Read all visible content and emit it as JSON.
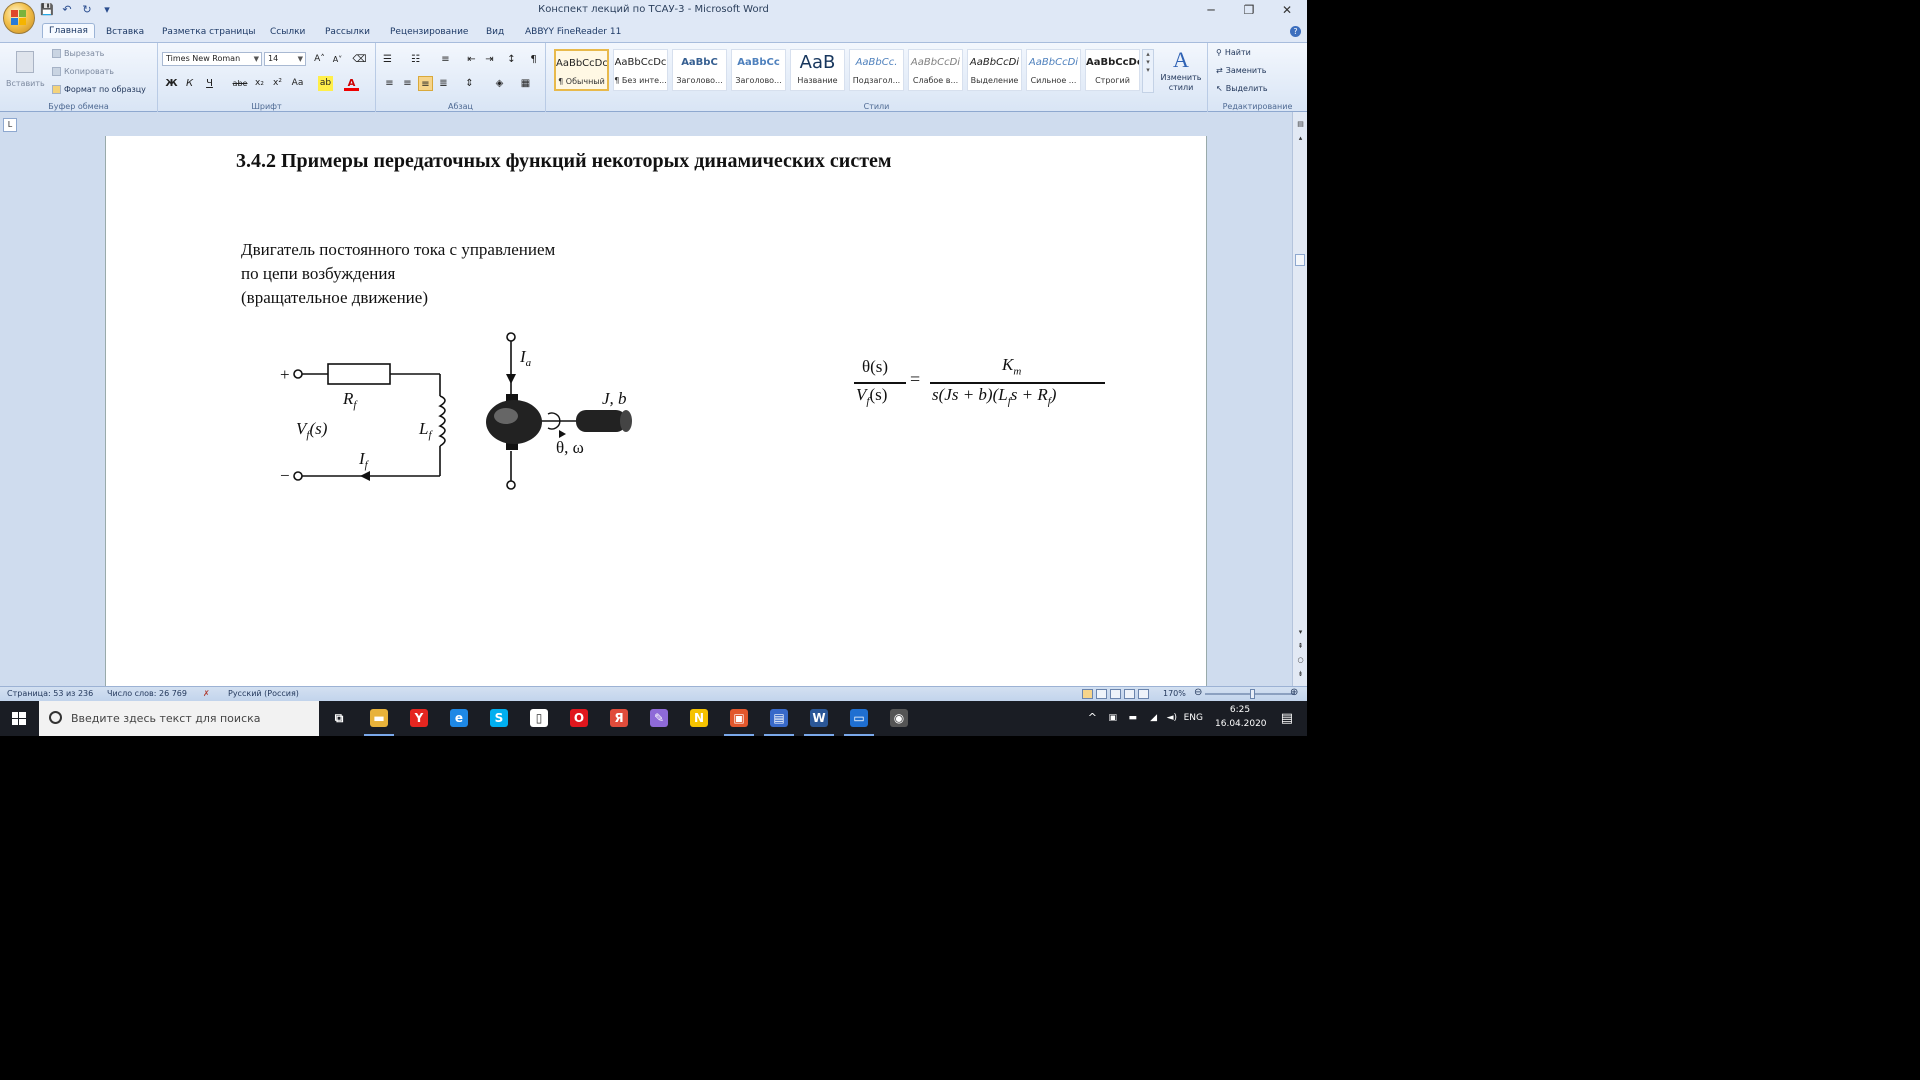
{
  "window": {
    "title": "Конспект лекций по ТСАУ-3 - Microsoft Word",
    "controls": [
      "─",
      "❐",
      "✕"
    ]
  },
  "qat": [
    "💾",
    "↶",
    "↻",
    "▾"
  ],
  "tabs": [
    {
      "label": "Главная",
      "active": true
    },
    {
      "label": "Вставка"
    },
    {
      "label": "Разметка страницы"
    },
    {
      "label": "Ссылки"
    },
    {
      "label": "Рассылки"
    },
    {
      "label": "Рецензирование"
    },
    {
      "label": "Вид"
    },
    {
      "label": "ABBYY FineReader 11"
    }
  ],
  "ribbon": {
    "clipboard": {
      "paste": "Вставить",
      "cut": "Вырезать",
      "copy": "Копировать",
      "format_painter": "Формат по образцу",
      "label": "Буфер обмена"
    },
    "font": {
      "name": "Times New Roman",
      "size": "14",
      "grow": "A˄",
      "shrink": "A˅",
      "clear": "⌫",
      "bold": "Ж",
      "italic": "К",
      "underline": "Ч",
      "strike": "abe",
      "subscript": "x₂",
      "superscript": "x²",
      "case": "Aa",
      "highlight": "ab",
      "color": "A",
      "label": "Шрифт"
    },
    "paragraph": {
      "label": "Абзац",
      "pilcrow": "¶"
    },
    "styles": {
      "label": "Стили",
      "items": [
        {
          "sample": "AaBbCcDc",
          "name": "¶ Обычный",
          "selected": true
        },
        {
          "sample": "AaBbCcDc",
          "name": "¶ Без инте..."
        },
        {
          "sample": "AaBbC",
          "name": "Заголово...",
          "color": "#365f91"
        },
        {
          "sample": "AaBbCc",
          "name": "Заголово...",
          "color": "#4f81bd"
        },
        {
          "sample": "AaB",
          "name": "Название",
          "color": "#17365d"
        },
        {
          "sample": "AaBbCc.",
          "name": "Подзагол...",
          "color": "#4f81bd"
        },
        {
          "sample": "AaBbCcDi",
          "name": "Слабое в...",
          "color": "#808080"
        },
        {
          "sample": "AaBbCcDi",
          "name": "Выделение"
        },
        {
          "sample": "AaBbCcDi",
          "name": "Сильное ...",
          "color": "#4f81bd"
        },
        {
          "sample": "AaBbCcDc",
          "name": "Строгий"
        }
      ],
      "change_styles": "Изменить стили"
    },
    "editing": {
      "find": "Найти",
      "replace": "Заменить",
      "select": "Выделить",
      "label": "Редактирование"
    }
  },
  "ruler_button": "L",
  "document": {
    "heading": "3.4.2 Примеры передаточных функций некоторых динамических систем",
    "motor_lines": [
      "Двигатель постоянного тока с управлением",
      "по цепи возбуждения",
      "(вращательное движение)"
    ],
    "circuit_labels": {
      "plus": "+",
      "minus": "−",
      "R": "R",
      "R_sub": "f",
      "V": "V",
      "V_sub": "f",
      "V_arg": "(s)",
      "L": "L",
      "L_sub": "f",
      "I_f": "I",
      "I_f_sub": "f",
      "I_a": "I",
      "I_a_sub": "a",
      "Jb": "J, b",
      "theta_omega": "θ, ω"
    },
    "formula": {
      "lhs_num": "θ(s)",
      "lhs_den_V": "V",
      "lhs_den_sub": "f",
      "lhs_den_arg": "(s)",
      "equals": "=",
      "rhs_num": "K",
      "rhs_num_sub": "m",
      "rhs_den": "s(Js + b)(L",
      "rhs_den_sub1": "f",
      "rhs_den_mid": "s + R",
      "rhs_den_sub2": "f",
      "rhs_den_end": ")"
    }
  },
  "statusbar": {
    "page": "Страница: 53 из 236",
    "words": "Число слов: 26 769",
    "language": "Русский (Россия)",
    "zoom": "170%"
  },
  "taskbar": {
    "search_placeholder": "Введите здесь текст для поиска",
    "icons": [
      {
        "name": "task-view-icon",
        "glyph": "⧉",
        "color": "transparent"
      },
      {
        "name": "file-explorer-icon",
        "glyph": "▬",
        "color": "#e8b23a"
      },
      {
        "name": "yandex-browser-icon",
        "glyph": "Y",
        "color": "#e52620"
      },
      {
        "name": "edge-icon",
        "glyph": "e",
        "color": "#1e88e5"
      },
      {
        "name": "skype-icon",
        "glyph": "S",
        "color": "#00aff0"
      },
      {
        "name": "document-icon",
        "glyph": "▯",
        "color": "#ffffff"
      },
      {
        "name": "opera-icon",
        "glyph": "O",
        "color": "#e0161d"
      },
      {
        "name": "yandex-icon",
        "glyph": "Я",
        "color": "#e04c3b"
      },
      {
        "name": "pen-icon",
        "glyph": "✎",
        "color": "#8e6ad8"
      },
      {
        "name": "norton-icon",
        "glyph": "N",
        "color": "#f5c200"
      },
      {
        "name": "pdf-icon",
        "glyph": "▣",
        "color": "#e2572c"
      },
      {
        "name": "save-app-icon",
        "glyph": "▤",
        "color": "#3869c9"
      },
      {
        "name": "word-icon",
        "glyph": "W",
        "color": "#2b5797"
      },
      {
        "name": "monitor-app-icon",
        "glyph": "▭",
        "color": "#1f6fd1"
      },
      {
        "name": "obs-icon",
        "glyph": "◉",
        "color": "#555"
      }
    ],
    "lang": "ENG",
    "time": "6:25",
    "date": "16.04.2020"
  }
}
